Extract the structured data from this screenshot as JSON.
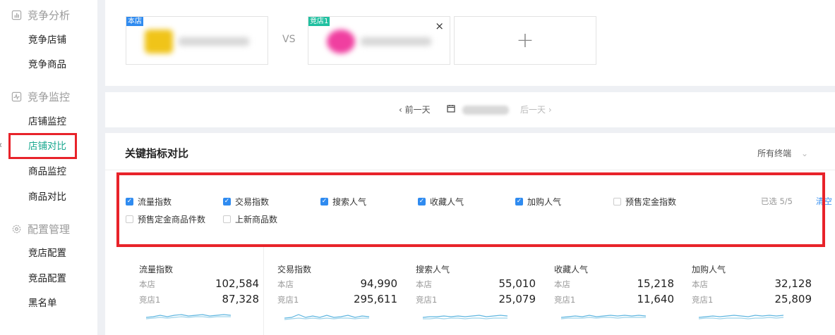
{
  "sidebar": {
    "groups": [
      {
        "label": "竞争分析",
        "items": [
          "竞争店铺",
          "竞争商品"
        ]
      },
      {
        "label": "竞争监控",
        "items": [
          "店铺监控",
          "店铺对比",
          "商品监控",
          "商品对比"
        ]
      },
      {
        "label": "配置管理",
        "items": [
          "竞店配置",
          "竞品配置",
          "黑名单"
        ]
      }
    ],
    "active_item": "店铺对比"
  },
  "compare": {
    "own_tag": "本店",
    "competitor_tag": "竞店1",
    "vs": "VS",
    "close": "×",
    "add": "+"
  },
  "datebar": {
    "prev": "前一天",
    "next": "后一天"
  },
  "metrics_section": {
    "title": "关键指标对比",
    "terminal": "所有终端",
    "checkboxes": [
      {
        "label": "流量指数",
        "checked": true
      },
      {
        "label": "交易指数",
        "checked": true
      },
      {
        "label": "搜索人气",
        "checked": true
      },
      {
        "label": "收藏人气",
        "checked": true
      },
      {
        "label": "加购人气",
        "checked": true
      },
      {
        "label": "预售定金指数",
        "checked": false
      },
      {
        "label": "预售定金商品件数",
        "checked": false
      },
      {
        "label": "上新商品数",
        "checked": false
      }
    ],
    "selected_count": "已选 5/5",
    "clear": "清空",
    "cards": [
      {
        "title": "流量指数",
        "own_label": "本店",
        "own_value": "102,584",
        "comp_label": "竞店1",
        "comp_value": "87,328"
      },
      {
        "title": "交易指数",
        "own_label": "本店",
        "own_value": "94,990",
        "comp_label": "竞店1",
        "comp_value": "295,611"
      },
      {
        "title": "搜索人气",
        "own_label": "本店",
        "own_value": "55,010",
        "comp_label": "竞店1",
        "comp_value": "25,079"
      },
      {
        "title": "收藏人气",
        "own_label": "本店",
        "own_value": "15,218",
        "comp_label": "竞店1",
        "comp_value": "11,640"
      },
      {
        "title": "加购人气",
        "own_label": "本店",
        "own_value": "32,128",
        "comp_label": "竞店1",
        "comp_value": "25,809"
      }
    ]
  },
  "colors": {
    "accent": "#1aa890",
    "link": "#2f8bf0",
    "highlight": "#e8232a",
    "sparkline": "#5fb6e0"
  }
}
